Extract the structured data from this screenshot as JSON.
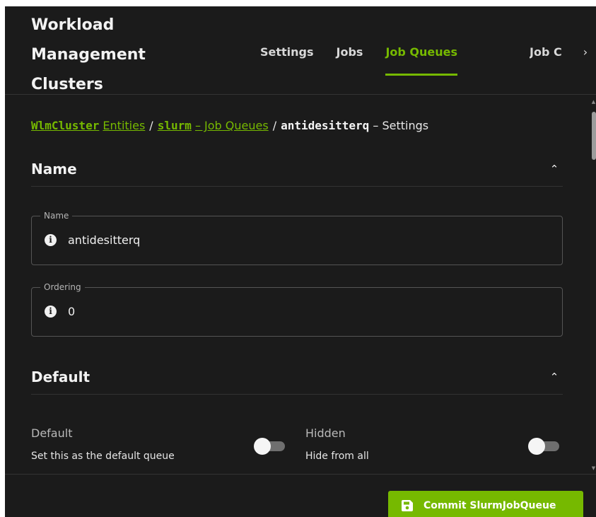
{
  "header": {
    "app_title": "Workload Management Clusters",
    "tabs": [
      {
        "label": "Settings",
        "active": false
      },
      {
        "label": "Jobs",
        "active": false
      },
      {
        "label": "Job Queues",
        "active": true
      }
    ],
    "overflow_tab_label": "Job C",
    "more_tabs_icon": "chevron-right-icon"
  },
  "breadcrumb": {
    "cluster_code": "WlmCluster",
    "cluster_label": "Entities",
    "separator": "/",
    "scheduler_code": "slurm",
    "scheduler_label": "– Job Queues",
    "current_code": "antidesitterq",
    "current_label": "– Settings"
  },
  "sections": {
    "name": {
      "title": "Name",
      "collapse_icon": "chevron-up-icon",
      "fields": {
        "name": {
          "label": "Name",
          "value": "antidesitterq"
        },
        "ordering": {
          "label": "Ordering",
          "value": "0"
        }
      }
    },
    "default": {
      "title": "Default",
      "collapse_icon": "chevron-up-icon",
      "toggles": {
        "default": {
          "label": "Default",
          "description": "Set this as the default queue",
          "checked": false
        },
        "hidden": {
          "label": "Hidden",
          "description": "Hide from all",
          "checked": false
        }
      }
    }
  },
  "footer": {
    "commit_label": "Commit SlurmJobQueue",
    "commit_icon": "save-icon"
  },
  "colors": {
    "accent": "#76b900",
    "background": "#1b1b1b",
    "text": "#ededed"
  }
}
